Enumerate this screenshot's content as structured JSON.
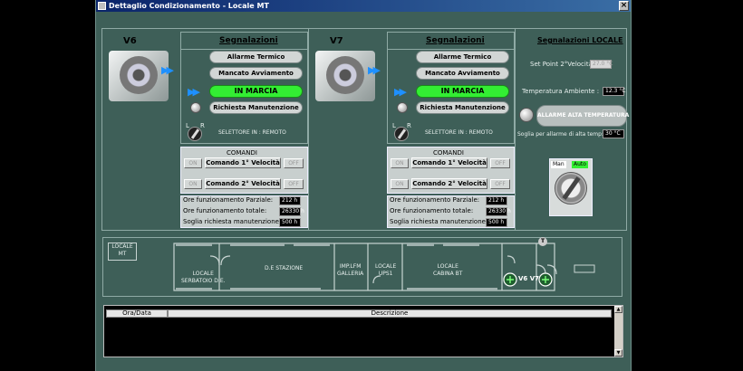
{
  "window": {
    "title": "Dettaglio Condizionamento - Locale MT",
    "close": "×"
  },
  "units": [
    {
      "name": "V6",
      "signals_title": "Segnalazioni",
      "signals": [
        "Allarme Termico",
        "Mancato Avviamento",
        "IN MARCIA",
        "Richiesta Manutenzione"
      ],
      "selector_left": "L",
      "selector_right": "R",
      "selector_label": "SELETTORE IN : REMOTO",
      "commands_title": "COMANDI",
      "cmd_on": "ON",
      "cmd_off": "OFF",
      "cmd1": "Comando 1° Velocità",
      "cmd2": "Comando 2° Velocità",
      "hours_partial_label": "Ore funzionamento Parziale:",
      "hours_partial": "212 h",
      "hours_total_label": "Ore funzionamento totale:",
      "hours_total": "26330 h",
      "maint_label": "Soglia richiesta manutenzione (h):",
      "maint": "500 h"
    },
    {
      "name": "V7",
      "signals_title": "Segnalazioni",
      "signals": [
        "Allarme Termico",
        "Mancato Avviamento",
        "IN MARCIA",
        "Richiesta Manutenzione"
      ],
      "selector_left": "L",
      "selector_right": "R",
      "selector_label": "SELETTORE IN : REMOTO",
      "commands_title": "COMANDI",
      "cmd_on": "ON",
      "cmd_off": "OFF",
      "cmd1": "Comando 1° Velocità",
      "cmd2": "Comando 2° Velocità",
      "hours_partial_label": "Ore funzionamento Parziale:",
      "hours_partial": "212 h",
      "hours_total_label": "Ore funzionamento totale:",
      "hours_total": "26330 h",
      "maint_label": "Soglia richiesta manutenzione (h):",
      "maint": "500 h"
    }
  ],
  "local": {
    "title": "Segnalazioni LOCALE",
    "setpoint_label": "Set Point 2°Velocità:",
    "setpoint": "27.0 °C",
    "temp_label": "Temperatura Ambiente :",
    "temp": "12.3 °C",
    "alarm": "ALLARME ALTA TEMPERATURA",
    "threshold_label": "Soglia per allarme di alta temp:",
    "threshold": "30 °C",
    "mode_manual": "Man",
    "mode_auto": "Auto"
  },
  "plan": {
    "locale_label": "LOCALE\nMT",
    "rooms": [
      "LOCALE\nSERBATOIO D.E.",
      "D.E STAZIONE",
      "IMP.LFM\nGALLERIA",
      "LOCALE\nUPS1",
      "LOCALE\nCABINA BT"
    ],
    "fan_label": "V6 V7",
    "thermo": "T"
  },
  "log": {
    "col_time": "Ora/Data",
    "col_desc": "Descrizione"
  },
  "colors": {
    "running": "#33ee33",
    "window_bg": "#3e5f58",
    "title_bar": "#0a246a"
  }
}
